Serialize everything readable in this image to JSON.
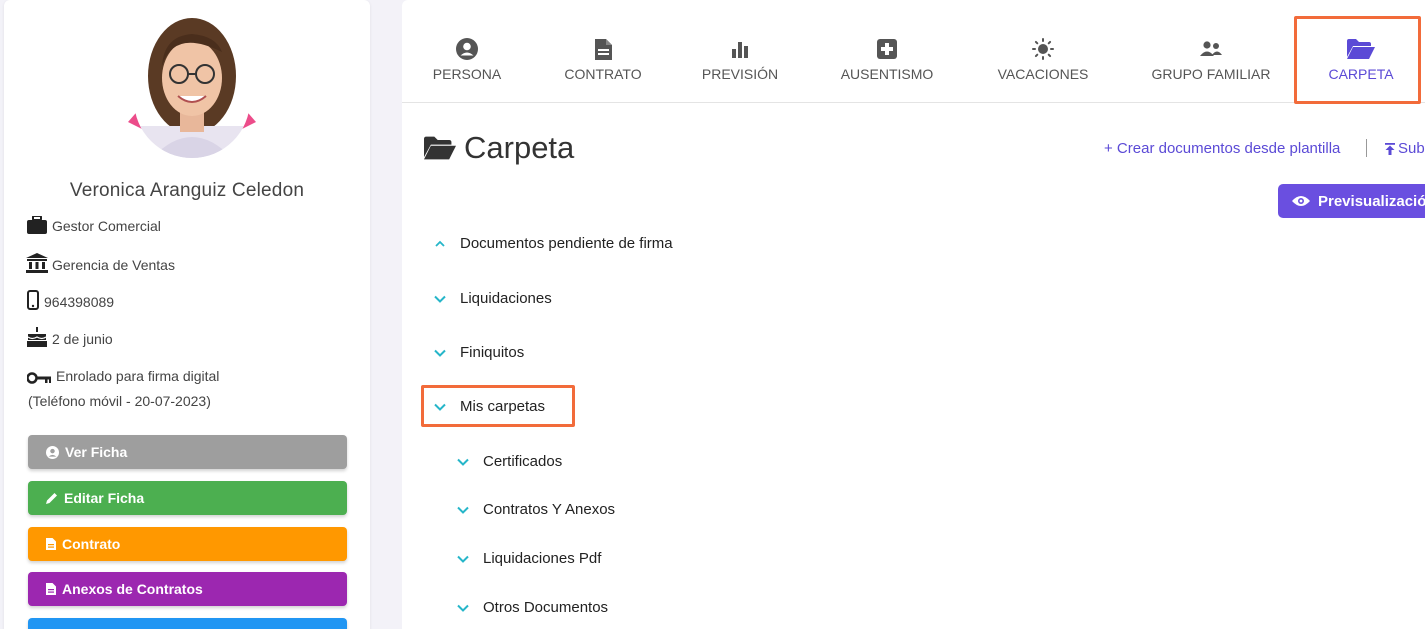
{
  "profile": {
    "name": "Veronica Aranguiz Celedon",
    "position": "Gestor Comercial",
    "department": "Gerencia de Ventas",
    "phone": "964398089",
    "birthday": "2 de junio",
    "signature_status": "Enrolado para firma digital",
    "signature_detail": "(Teléfono móvil - 20-07-2023)"
  },
  "actions": [
    {
      "label": "Ver Ficha",
      "color": "#9e9e9e",
      "icon": "user-circle-icon"
    },
    {
      "label": "Editar Ficha",
      "color": "#4caf50",
      "icon": "pencil-icon"
    },
    {
      "label": "Contrato",
      "color": "#ff9800",
      "icon": "document-icon"
    },
    {
      "label": "Anexos de Contratos",
      "color": "#9c27b0",
      "icon": "document-icon"
    },
    {
      "label": "",
      "color": "#2196f3",
      "icon": ""
    }
  ],
  "tabs": [
    {
      "label": "PERSONA",
      "icon": "person-icon"
    },
    {
      "label": "CONTRATO",
      "icon": "document-icon"
    },
    {
      "label": "PREVISIÓN",
      "icon": "bar-chart-icon"
    },
    {
      "label": "AUSENTISMO",
      "icon": "medical-cross-icon"
    },
    {
      "label": "VACACIONES",
      "icon": "sun-icon"
    },
    {
      "label": "GRUPO FAMILIAR",
      "icon": "people-icon"
    },
    {
      "label": "CARPETA",
      "icon": "folder-open-icon",
      "active": true
    }
  ],
  "main": {
    "title": "Carpeta",
    "create_link": "+ Crear documentos desde plantilla",
    "upload_link": "Sub",
    "preview_button": "Previsualizació"
  },
  "tree": [
    {
      "label": "Documentos pendiente de firma",
      "expanded": true,
      "level": 0
    },
    {
      "label": "Liquidaciones",
      "expanded": false,
      "level": 0
    },
    {
      "label": "Finiquitos",
      "expanded": false,
      "level": 0
    },
    {
      "label": "Mis carpetas",
      "expanded": false,
      "level": 0
    },
    {
      "label": "Certificados",
      "expanded": false,
      "level": 1
    },
    {
      "label": "Contratos Y Anexos",
      "expanded": false,
      "level": 1
    },
    {
      "label": "Liquidaciones Pdf",
      "expanded": false,
      "level": 1
    },
    {
      "label": "Otros Documentos",
      "expanded": false,
      "level": 1
    }
  ],
  "colors": {
    "accent": "#5b4ad6",
    "highlight": "#f26b3a",
    "chevron": "#26b6c9"
  }
}
